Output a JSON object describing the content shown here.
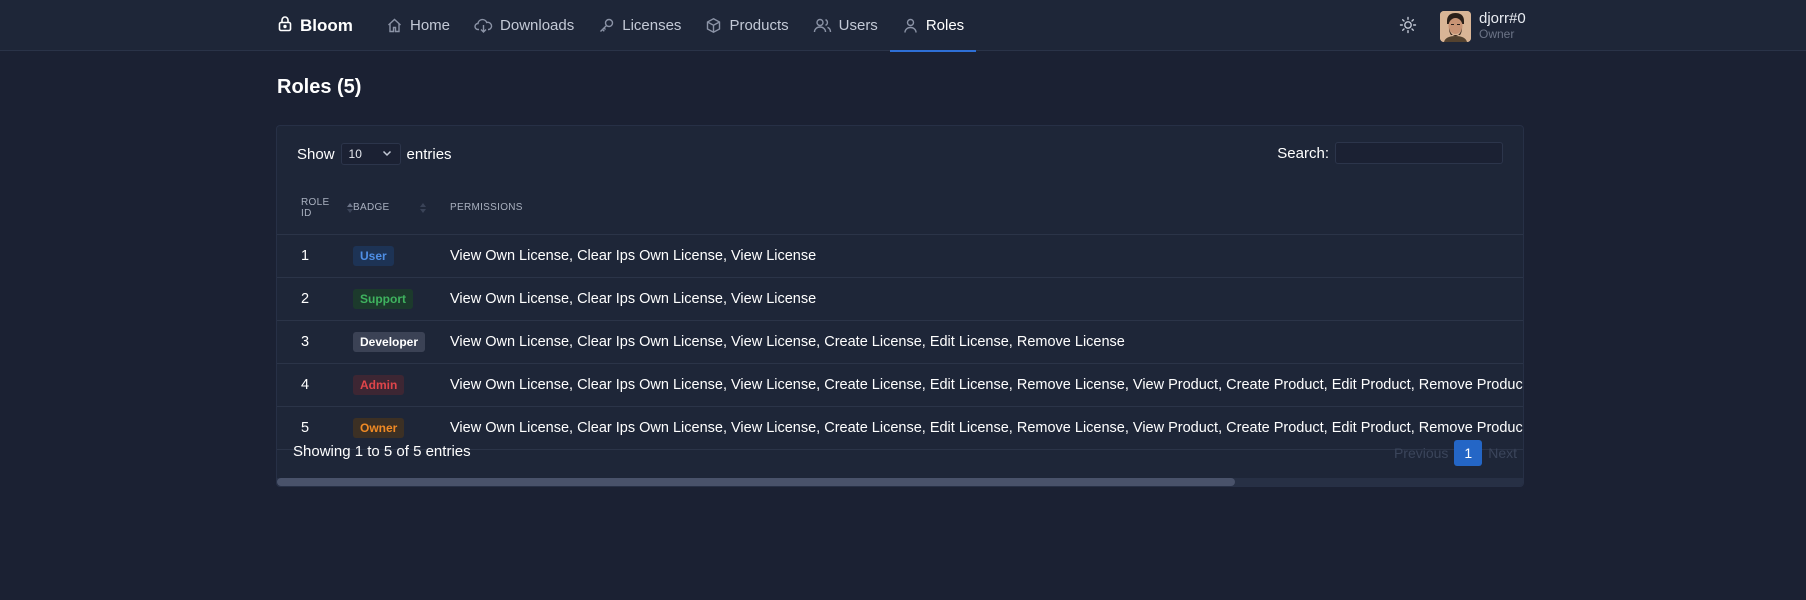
{
  "brand": {
    "name": "Bloom",
    "icon": "lock-icon"
  },
  "nav": {
    "items": [
      {
        "label": "Home",
        "icon": "home-icon"
      },
      {
        "label": "Downloads",
        "icon": "cloud-download-icon"
      },
      {
        "label": "Licenses",
        "icon": "key-icon"
      },
      {
        "label": "Products",
        "icon": "box-icon"
      },
      {
        "label": "Users",
        "icon": "users-icon"
      },
      {
        "label": "Roles",
        "icon": "user-icon",
        "active": true
      }
    ]
  },
  "user": {
    "name": "djorr#0",
    "role": "Owner"
  },
  "page": {
    "title": "Roles (5)"
  },
  "controls": {
    "show_label": "Show",
    "entries_value": "10",
    "entries_label": "entries",
    "search_label": "Search:",
    "search_value": ""
  },
  "table": {
    "headers": {
      "id": "ROLE ID",
      "badge": "BADGE",
      "permissions": "PERMISSIONS"
    },
    "rows": [
      {
        "id": "1",
        "badge": "User",
        "permissions": "View Own License, Clear Ips Own License, View License"
      },
      {
        "id": "2",
        "badge": "Support",
        "permissions": "View Own License, Clear Ips Own License, View License"
      },
      {
        "id": "3",
        "badge": "Developer",
        "permissions": "View Own License, Clear Ips Own License, View License, Create License, Edit License, Remove License"
      },
      {
        "id": "4",
        "badge": "Admin",
        "permissions": "View Own License, Clear Ips Own License, View License, Create License, Edit License, Remove License, View Product, Create Product, Edit Product, Remove Product"
      },
      {
        "id": "5",
        "badge": "Owner",
        "permissions": "View Own License, Clear Ips Own License, View License, Create License, Edit License, Remove License, View Product, Create Product, Edit Product, Remove Product"
      }
    ]
  },
  "badge_colors": {
    "User": {
      "fg": "#4f8fe6",
      "bg": "#1d3355"
    },
    "Support": {
      "fg": "#3fb35f",
      "bg": "#1c3a2c"
    },
    "Developer": {
      "fg": "#ffffff",
      "bg": "#3b4255"
    },
    "Admin": {
      "fg": "#e0454a",
      "bg": "#3d2633"
    },
    "Owner": {
      "fg": "#f08a24",
      "bg": "#3c3024"
    }
  },
  "footer": {
    "info": "Showing 1 to 5 of 5 entries",
    "previous": "Previous",
    "page": "1",
    "next": "Next"
  }
}
